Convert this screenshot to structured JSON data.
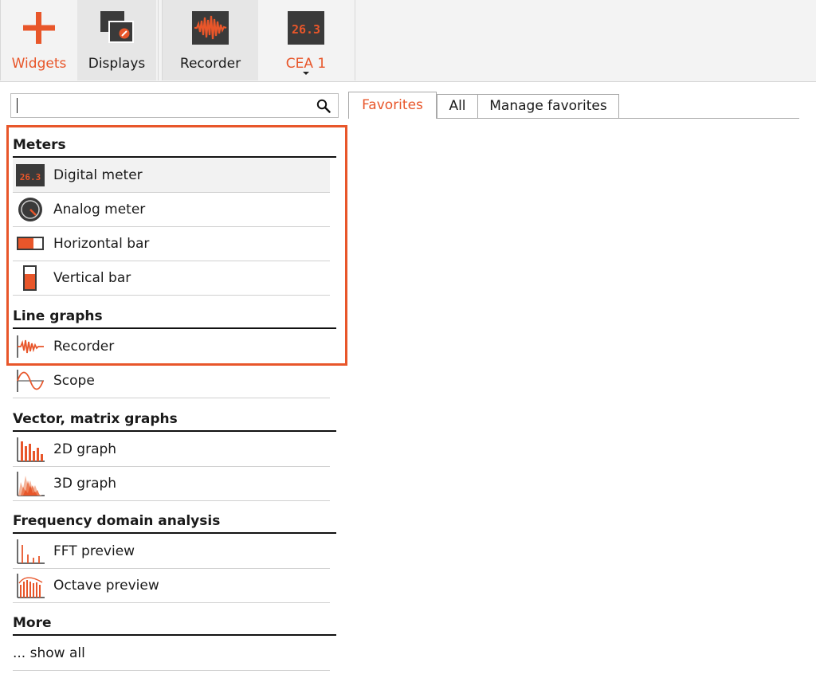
{
  "toolbar": {
    "widgets_label": "Widgets",
    "displays_label": "Displays",
    "recorder_label": "Recorder",
    "cea_label": "CEA 1",
    "cea_icon_text": "26.3"
  },
  "search": {
    "value": "",
    "placeholder": ""
  },
  "tabs": [
    {
      "label": "Favorites",
      "active": true
    },
    {
      "label": "All",
      "active": false
    },
    {
      "label": "Manage favorites",
      "active": false
    }
  ],
  "sections": [
    {
      "title": "Meters",
      "items": [
        {
          "label": "Digital meter",
          "icon": "digital-meter-icon",
          "selected": true
        },
        {
          "label": "Analog meter",
          "icon": "analog-meter-icon"
        },
        {
          "label": "Horizontal bar",
          "icon": "horizontal-bar-icon"
        },
        {
          "label": "Vertical bar",
          "icon": "vertical-bar-icon"
        }
      ]
    },
    {
      "title": "Line graphs",
      "items": [
        {
          "label": "Recorder",
          "icon": "recorder-icon"
        },
        {
          "label": "Scope",
          "icon": "scope-icon"
        }
      ]
    },
    {
      "title": "Vector, matrix graphs",
      "items": [
        {
          "label": "2D graph",
          "icon": "2d-graph-icon"
        },
        {
          "label": "3D graph",
          "icon": "3d-graph-icon"
        }
      ]
    },
    {
      "title": "Frequency domain analysis",
      "items": [
        {
          "label": "FFT preview",
          "icon": "fft-preview-icon"
        },
        {
          "label": "Octave preview",
          "icon": "octave-preview-icon"
        }
      ]
    },
    {
      "title": "More",
      "items": [
        {
          "label": "... show all",
          "icon": ""
        }
      ]
    }
  ],
  "colors": {
    "accent": "#e8562a",
    "dark": "#3a3a3a"
  }
}
